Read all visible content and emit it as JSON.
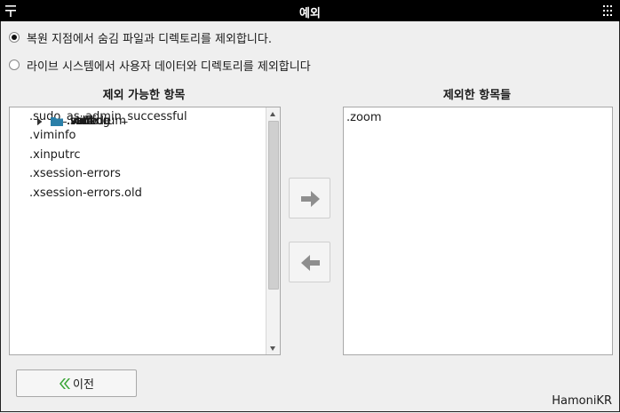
{
  "window": {
    "title": "예외",
    "menu_icon": "menu-icon",
    "grid_icon": "grid-icon"
  },
  "options": {
    "restore_label": "복원 지점에서 숨김 파일과 디렉토리를 제외합니다.",
    "live_label": "라이브 시스템에서 사용자 데이터와 디렉토리를 제외합니다",
    "selected": "restore"
  },
  "excludable": {
    "title": "제외 가능한 항목",
    "items": [
      {
        "label": ".softforum",
        "kind": "folder"
      },
      {
        "label": ".ssh",
        "kind": "folder"
      },
      {
        "label": ".sts4",
        "kind": "folder"
      },
      {
        "label": ".sudo_as_admin_successful",
        "kind": "file"
      },
      {
        "label": ".swt",
        "kind": "folder"
      },
      {
        "label": ".tooling",
        "kind": "folder"
      },
      {
        "label": ".var",
        "kind": "folder"
      },
      {
        "label": ".viminfo",
        "kind": "file"
      },
      {
        "label": ".vscode",
        "kind": "folder"
      },
      {
        "label": ".wine",
        "kind": "folder"
      },
      {
        "label": ".xinputrc",
        "kind": "file"
      },
      {
        "label": ".xsession-errors",
        "kind": "file"
      },
      {
        "label": ".xsession-errors.old",
        "kind": "file"
      }
    ]
  },
  "excluded": {
    "title": "제외한 항목들",
    "items": [
      ".zoom"
    ]
  },
  "buttons": {
    "add_icon": "arrow-right-icon",
    "remove_icon": "arrow-left-icon",
    "previous_label": "이전",
    "previous_icon": "double-chevron-left-icon"
  },
  "brand": "HamoniKR",
  "colors": {
    "folder": "#2b7fa8",
    "titlebar": "#000000",
    "prev_icon": "#3aa536"
  }
}
